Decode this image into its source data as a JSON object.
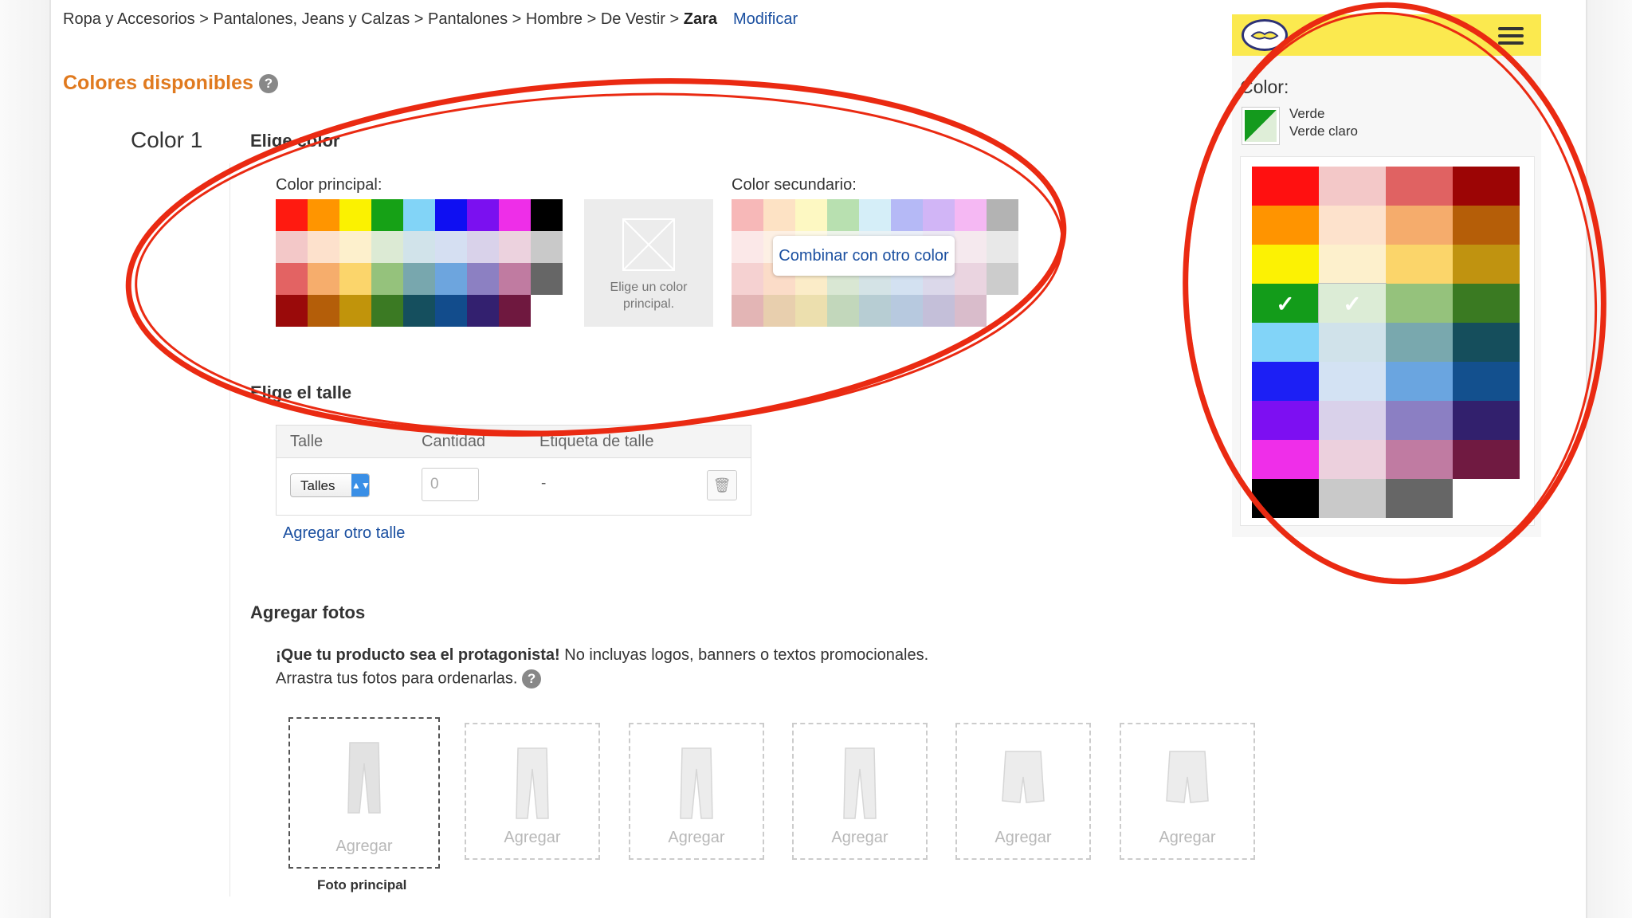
{
  "breadcrumb": {
    "path": "Ropa y Accesorios  >  Pantalones, Jeans y Calzas  >  Pantalones  >  Hombre  >  De Vestir  > ",
    "current": "Zara",
    "modify": "Modificar"
  },
  "section": {
    "title": "Colores disponibles",
    "help": "?"
  },
  "color_block": {
    "label": "Color 1",
    "choose_title": "Elige color",
    "primary_label": "Color principal:",
    "secondary_label": "Color secundario:",
    "placeholder_text_1": "Elige un color",
    "placeholder_text_2": "principal.",
    "combine_button": "Combinar con otro color",
    "primary_swatches": [
      "#ff1a10",
      "#ff9500",
      "#fbf200",
      "#16a116",
      "#82d4f7",
      "#0f0ff2",
      "#7b10f0",
      "#ee2ee8",
      "#000000",
      "#f3c8c8",
      "#fde1cc",
      "#fdf0cc",
      "#dcead4",
      "#d1e3ea",
      "#d5dff2",
      "#d9d2ea",
      "#ecd2de",
      "#c9c9c9",
      "#e36363",
      "#f6ad6c",
      "#fbd56b",
      "#95c27c",
      "#78a7ae",
      "#6da5de",
      "#8c80c2",
      "#c07ba1",
      "#666666",
      "#9a0a0a",
      "#b45e09",
      "#c1940b",
      "#3b7a23",
      "#154f5e",
      "#124c8c",
      "#33206f",
      "#6f183f",
      "#ffffff"
    ],
    "secondary_swatches": [
      "#f7b8b8",
      "#fde2c4",
      "#fdf8c2",
      "#b8e0b0",
      "#d5eef8",
      "#b5b9f6",
      "#d1b5f6",
      "#f5b8f3",
      "#b3b3b3",
      "#fbe8e8",
      "#fdf0e4",
      "#fdf9e6",
      "#edf4ea",
      "#e9f2f5",
      "#eaeef8",
      "#ece8f4",
      "#f5e9ee",
      "#e8e8e8",
      "#f5d1d1",
      "#fbdcc8",
      "#fbecc8",
      "#d9e7d3",
      "#d4e3e6",
      "#d3e1f1",
      "#dbd8ea",
      "#ead4e0",
      "#cccccc",
      "#e3b5b5",
      "#e8cfae",
      "#ecdfae",
      "#c2d7bb",
      "#b7cdd3",
      "#b7c9df",
      "#c4bfd9",
      "#d9bccb",
      "#ffffff"
    ]
  },
  "size_block": {
    "title": "Elige el talle",
    "col_size": "Talle",
    "col_qty": "Cantidad",
    "col_label": "Etiqueta de talle",
    "select_value": "Talles",
    "qty_value": "0",
    "dash": "-",
    "add_link": "Agregar otro talle"
  },
  "photos_block": {
    "title": "Agregar fotos",
    "tip_bold": "¡Que tu producto sea el protagonista!",
    "tip_rest": " No incluyas logos, banners o textos promocionales.",
    "tip_line2": "Arrastra tus fotos para ordenarlas.",
    "add_label": "Agregar",
    "main_caption": "Foto principal"
  },
  "mobile": {
    "color_label": "Color:",
    "primary_name": "Verde",
    "secondary_name": "Verde claro",
    "check_mark": "✓",
    "grid": [
      "#ff1010",
      "#f3c8c8",
      "#e06262",
      "#9c0505",
      "#ff9400",
      "#fde2cc",
      "#f5ac6c",
      "#b55e08",
      "#fcf203",
      "#fdf0cc",
      "#fbd56a",
      "#c09310",
      "#139c1a",
      "#dcecd6",
      "#95c27c",
      "#3a7a22",
      "#82d4f8",
      "#d0e2ea",
      "#79a8ae",
      "#154e5c",
      "#1c1ff5",
      "#d3e2f3",
      "#6aa5e0",
      "#13508e",
      "#7d0ff2",
      "#d9d1ea",
      "#8b7fc3",
      "#32206d",
      "#ef2ee9",
      "#ecd0dd",
      "#c07ba2",
      "#701a41",
      "#000000",
      "#c9c9c9",
      "#666666",
      "#ffffff"
    ]
  },
  "accent_colors": {
    "annotation_red": "#ea2a12",
    "orange_title": "#e07a1f",
    "link_blue": "#1a4fa0",
    "header_yellow": "#fbe94f"
  }
}
